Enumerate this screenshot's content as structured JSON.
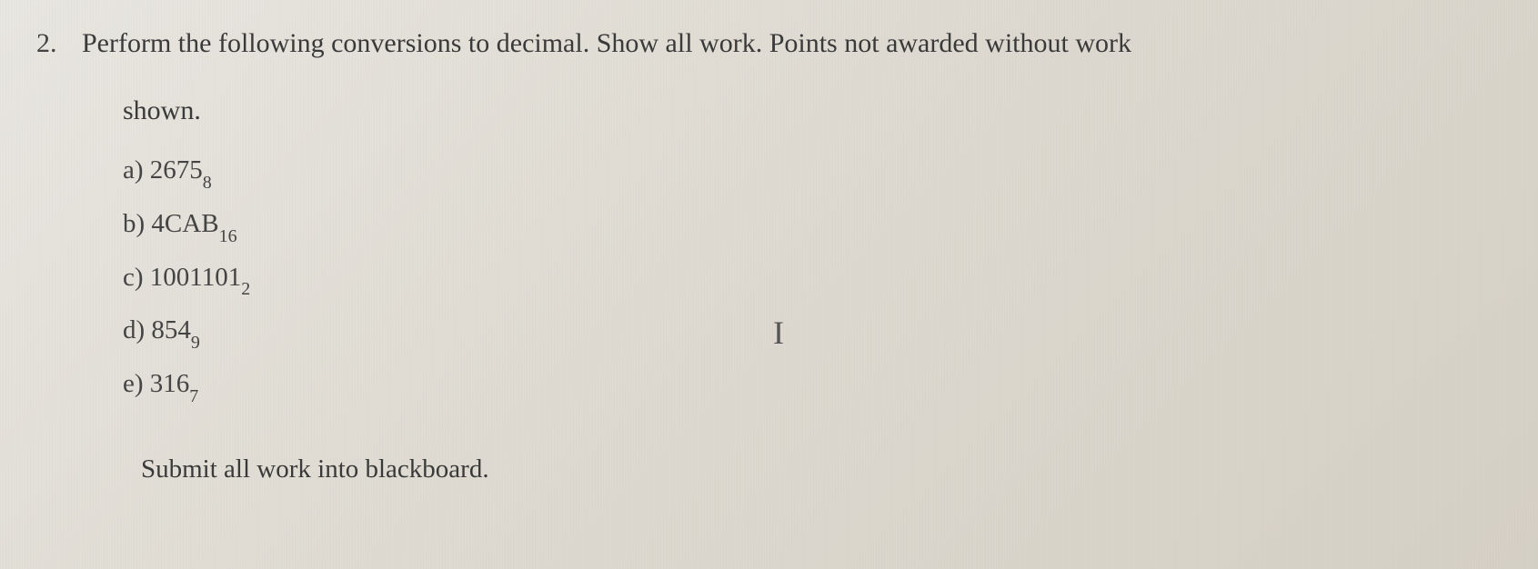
{
  "question": {
    "number": "2.",
    "text_line1": "Perform the following conversions to decimal. Show all work. Points not awarded without work",
    "text_line2": "shown."
  },
  "items": [
    {
      "label": "a)",
      "value": "2675",
      "base": "8"
    },
    {
      "label": "b)",
      "value": "4CAB",
      "base": "16"
    },
    {
      "label": "c)",
      "value": "1001101",
      "base": "2"
    },
    {
      "label": "d)",
      "value": "854",
      "base": "9"
    },
    {
      "label": "e)",
      "value": "316",
      "base": "7"
    }
  ],
  "footer": "Submit all work into blackboard.",
  "cursor_glyph": "I"
}
